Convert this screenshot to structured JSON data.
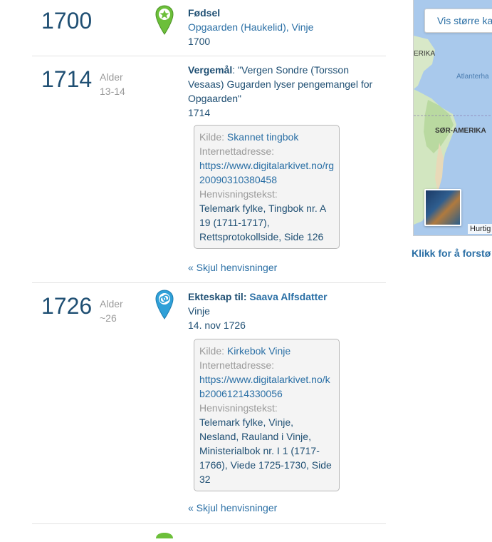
{
  "events": [
    {
      "year": "1700",
      "title": "Fødsel",
      "place": "Opgaarden (Haukelid), Vinje",
      "date": "1700"
    },
    {
      "year": "1714",
      "age_label": "Alder",
      "age_value": "13-14",
      "title": "Vergemål",
      "description": ": \"Vergen Sondre (Torsson Vesaas) Gugarden lyser pengemangel for Opgaarden\"",
      "date": "1714",
      "source": {
        "kilde_label": "Kilde:",
        "kilde_value": "Skannet tingbok",
        "url_label": "Internettadresse:",
        "url_value": "https://www.digitalarkivet.no/rg20090310380458",
        "ref_label": "Henvisningstekst:",
        "ref_value": "Telemark fylke, Tingbok nr. A 19 (1711-1717), Rettsprotokollside, Side 126"
      },
      "hide_link": "« Skjul henvisninger"
    },
    {
      "year": "1726",
      "age_label": "Alder",
      "age_value": "~26",
      "title": "Ekteskap til:",
      "spouse": "Saava Alfsdatter",
      "place": "Vinje",
      "date": "14. nov 1726",
      "source": {
        "kilde_label": "Kilde:",
        "kilde_value": "Kirkebok Vinje",
        "url_label": "Internettadresse:",
        "url_value": "https://www.digitalarkivet.no/kb20061214330056",
        "ref_label": "Henvisningstekst:",
        "ref_value": "Telemark fylke, Vinje, Nesland, Rauland i Vinje, Ministerialbok nr. I 1 (1717-1766), Viede 1725-1730, Side 32"
      },
      "hide_link": "« Skjul henvisninger"
    }
  ],
  "map": {
    "button_label": "Vis større ka",
    "label_america": "ERIKA",
    "label_atlantic": "Atlanterha",
    "label_south_america": "SØR-AMERIKA",
    "attribution": "Hurtig",
    "caption": "Klikk for å forstø"
  },
  "colors": {
    "year": "#1f4f73",
    "link": "#2a6fa5",
    "pin_birth": "#6cbf3a",
    "pin_marriage": "#2fa0d8"
  }
}
